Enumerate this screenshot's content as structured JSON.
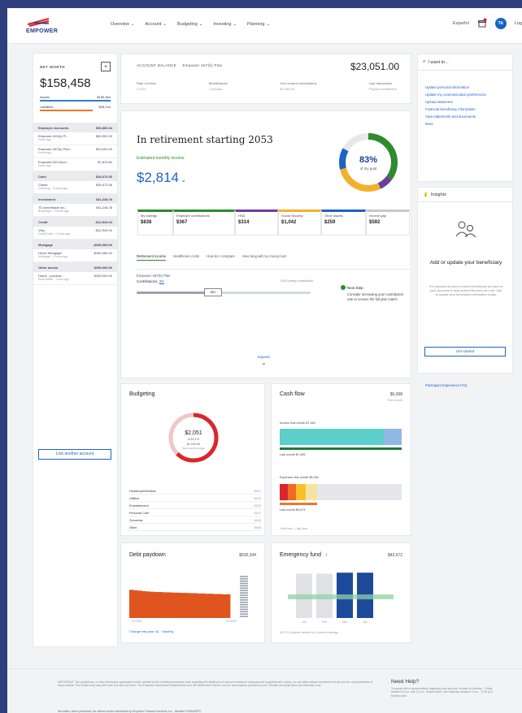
{
  "nav": {
    "logo": "EMPOWER",
    "items": [
      "Overview",
      "Account",
      "Budgeting",
      "Investing",
      "Planning"
    ],
    "lang": "Español",
    "avatar": "TA",
    "login": "Log"
  },
  "net_worth": {
    "title": "NET WORTH",
    "value": "$158,458",
    "assets_label": "Assets",
    "assets_value": "$180,364",
    "liabilities_label": "Liabilities",
    "liabilities_value": "$28,144",
    "groups": [
      {
        "name": "Employer Accounts",
        "value": "$93,866.34",
        "items": [
          {
            "name": "Empower 401(k) Pl...",
            "value": "$63,001.50",
            "sub": "Hours ago"
          },
          {
            "name": "Empower 457(b) Plan...",
            "value": "$23,051.00",
            "sub": "Hours ago"
          },
          {
            "name": "Empower 529 Acco...",
            "value": "$7,813.84",
            "sub": "Hours ago"
          }
        ]
      },
      {
        "name": "Cash",
        "value": "$34,673.36",
        "items": [
          {
            "name": "Chase",
            "value": "$34,673.36",
            "sub": "Checking · 3 hours ago"
          }
        ]
      },
      {
        "name": "Investment",
        "value": "$11,248.78",
        "items": [
          {
            "name": "TD Ameritrade Inv...",
            "value": "$11,248.78",
            "sub": "Brokerage · 3 hours ago"
          }
        ]
      },
      {
        "name": "Credit",
        "value": "-$12,544.04",
        "items": [
          {
            "name": "Visa",
            "value": "-$12,544.04",
            "sub": "Credit Card · 4 hours ago"
          }
        ]
      },
      {
        "name": "Mortgage",
        "value": "-$459,384.94",
        "items": [
          {
            "name": "Home Mortgage",
            "value": "-$459,384.94",
            "sub": "Mortgage · 2 hours ago"
          }
        ]
      },
      {
        "name": "Other assets",
        "value": "$390,000.00",
        "items": [
          {
            "name": "Home - purchas...",
            "value": "$390,000.00",
            "sub": "Real Estate · 1 hour ago"
          }
        ]
      }
    ],
    "link_button": "Link another account"
  },
  "account_header": {
    "label": "ACCOUNT BALANCE",
    "plan": "Empower 457(b) Plan",
    "balance": "$23,051.00",
    "fields": [
      {
        "label": "Rate of return",
        "value": "2.15%"
      },
      {
        "label": "Beneficiaries",
        "value": "1 primary"
      },
      {
        "label": "Your current contributions",
        "value": "$1,050.00"
      },
      {
        "label": "Last transaction",
        "value": "Payroll contribution"
      }
    ]
  },
  "retirement": {
    "title": "In retirement starting 2053",
    "monthly_label": "Estimated monthly income",
    "monthly_value": "$2,814",
    "goal_percent": "83%",
    "goal_label": "of my goal",
    "goal_fraction": 0.83,
    "tiles": [
      {
        "label": "My savings",
        "value": "$838",
        "color": "#2e8b2e"
      },
      {
        "label": "Employer contributions",
        "value": "$367",
        "color": "#2e8b2e"
      },
      {
        "label": "HSA",
        "value": "$314",
        "color": "#6b3fa0"
      },
      {
        "label": "Social Security",
        "value": "$1,042",
        "color": "#f3b12b"
      },
      {
        "label": "Other assets",
        "value": "$259",
        "color": "#1e62c8"
      },
      {
        "label": "Income gap",
        "value": "$592",
        "color": "#c8c8c8"
      }
    ],
    "tabs": [
      "Retirement income",
      "Healthcare costs",
      "How do I compare",
      "How long will my money last"
    ],
    "employer_label": "Empower 457(b) Plan",
    "contributions_label": "Contributions:",
    "contributions_value": "3%",
    "slider_value": "$50",
    "slider_fraction": 0.44,
    "limit_label": "2,000 yearly contribution",
    "next_step_title": "Next Step",
    "next_step_text": "Consider increasing your contribution rate to receive the full plan match",
    "expand": "Expand"
  },
  "budgeting": {
    "title": "Budgeting",
    "ring_value": "$2,051",
    "ring_line1": "of $3,475",
    "ring_line2": "$1,425 left",
    "ring_line3": "Total monthly budget",
    "rows": [
      {
        "label": "Healthcare/Medical",
        "value": "$591"
      },
      {
        "label": "Utilities",
        "value": "$342"
      },
      {
        "label": "Entertainment",
        "value": "$200"
      },
      {
        "label": "Personal Care",
        "value": "$187"
      },
      {
        "label": "Groceries",
        "value": "$163"
      },
      {
        "label": "Other",
        "value": "$569"
      }
    ]
  },
  "cashflow": {
    "title": "Cash flow",
    "value": "$5,098",
    "sub": "This month",
    "income_label": "Income this month $7,180",
    "last_income_label": "Last month $7,406",
    "spending_label": "Expenses this month $5,082",
    "last_spending_label": "Last month $5,674",
    "footer_link": "Cash flow — last year"
  },
  "debt": {
    "title": "Debt paydown",
    "value": "$500,344",
    "x_start": "7/1/2022",
    "x_end": "7/1/2023",
    "change_label": "Change this year: $1 · Monthly",
    "chart_data": {
      "type": "area",
      "values": [
        100,
        98,
        97,
        95,
        94,
        93,
        92,
        92,
        91,
        91,
        90,
        90,
        89,
        89,
        88,
        88,
        87,
        87,
        86,
        86,
        85,
        85,
        84,
        84
      ]
    }
  },
  "emergency": {
    "title": "Emergency fund",
    "info": "i",
    "value": "$43,672",
    "note": "$23,711 balance needed for 6 month coverage",
    "chart_data": {
      "type": "bar",
      "categories": [
        "Jan",
        "Feb",
        "Mar",
        "Apr"
      ],
      "values": [
        88,
        88,
        90,
        90
      ],
      "goal": 42,
      "colors": [
        "#dfe1e5",
        "#dfe1e5",
        "#1d4a9a",
        "#1d4a9a"
      ]
    }
  },
  "iwant": {
    "title": "I want to...",
    "items": [
      "Update personal information",
      "Update my communication preferences",
      "Upload statement",
      "Financial beneficiary information",
      "View statements and documents",
      "More"
    ]
  },
  "insights": {
    "title": "Insights",
    "heading": "Add or update your beneficiary",
    "body": "It's important to have a current beneficiary for each of your accounts to help protect the ones you love. Add or update your beneficiary information today.",
    "button": "Get started",
    "faq_link": "Participant Experience FAQ"
  },
  "footer": {
    "important": "IMPORTANT: The projections, or other information generated on this website by the investment analysis tools regarding the likelihood of various investment outcomes are hypothetical in nature, do not reflect actual investment results and are not guarantees of future results. The results may vary with each use and over time. The Empower Dashboard Requirements and the Retirement Planner use the assumptions provided by you. Results and projections are estimates only.",
    "securities": "Securities, when presented, are offered and/or distributed by Empower Financial Services, Inc., Member FINRA/SIPC.",
    "help_title": "Need Help?",
    "help_text": "To speak with a representative regarding your account, contact us Monday - Friday between 8 a.m. and 10 p.m. Eastern time, and Saturday between 9 a.m. - 5:30 p.m. Eastern time."
  }
}
